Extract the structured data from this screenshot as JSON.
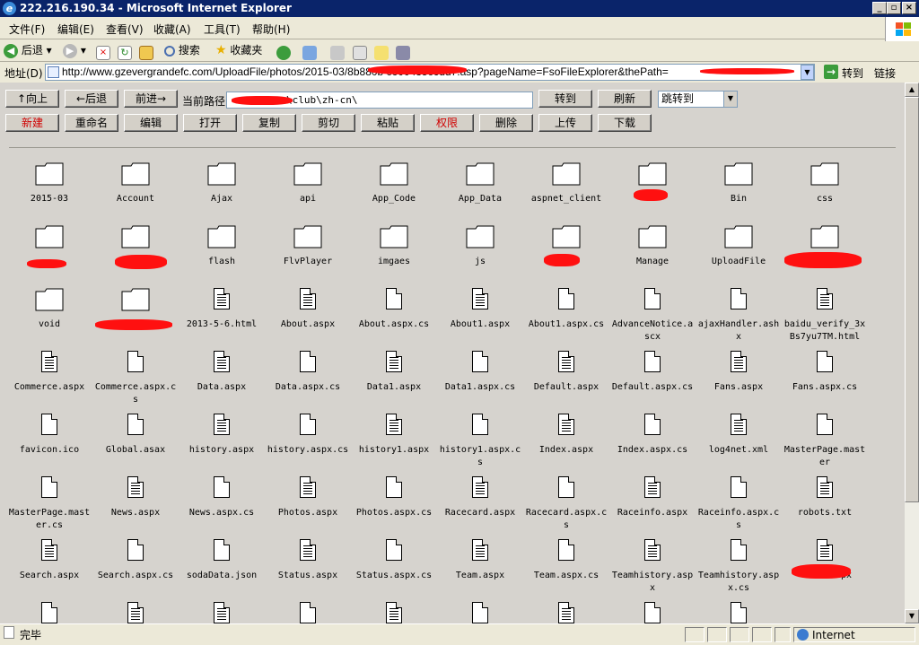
{
  "window": {
    "title": "222.216.190.34 - Microsoft Internet Explorer"
  },
  "menu": [
    "文件(F)",
    "编辑(E)",
    "查看(V)",
    "收藏(A)",
    "工具(T)",
    "帮助(H)"
  ],
  "toolbar": {
    "back": "后退",
    "search": "搜索",
    "favorites": "收藏夹"
  },
  "address": {
    "label": "地址(D)",
    "url": "http://www.gzevergrandefc.com/UploadFile/photos/2015-03/8b880b                       c600435c6dd7.asp?pageName=FsoFileExplorer&thePath=",
    "go": "转到",
    "links": "链接"
  },
  "panel": {
    "up": "↑向上",
    "back": "←后退",
    "forward": "前进→",
    "path_label": "当前路径",
    "path_value": "\\club\\zh-cn\\",
    "go": "转到",
    "refresh": "刷新",
    "jump": "跳转到"
  },
  "actions": [
    "新建",
    "重命名",
    "编辑",
    "打开",
    "复制",
    "剪切",
    "粘贴",
    "权限",
    "删除",
    "上传",
    "下载"
  ],
  "colors": {
    "titlebar": "#0a246a",
    "redact": "#ff1010",
    "red_text": "#d00000"
  },
  "items": [
    {
      "name": "2015-03",
      "type": "folder"
    },
    {
      "name": "Account",
      "type": "folder"
    },
    {
      "name": "Ajax",
      "type": "folder"
    },
    {
      "name": "api",
      "type": "folder"
    },
    {
      "name": "App_Code",
      "type": "folder"
    },
    {
      "name": "App_Data",
      "type": "folder"
    },
    {
      "name": "aspnet_client",
      "type": "folder"
    },
    {
      "name": "",
      "type": "folder",
      "redacted": true
    },
    {
      "name": "Bin",
      "type": "folder"
    },
    {
      "name": "css",
      "type": "folder"
    },
    {
      "name": "",
      "type": "folder",
      "redacted": true
    },
    {
      "name": "",
      "type": "folder",
      "redacted": true
    },
    {
      "name": "flash",
      "type": "folder"
    },
    {
      "name": "FlvPlayer",
      "type": "folder"
    },
    {
      "name": "imgaes",
      "type": "folder"
    },
    {
      "name": "js",
      "type": "folder"
    },
    {
      "name": "",
      "type": "folder",
      "redacted": true
    },
    {
      "name": "Manage",
      "type": "folder"
    },
    {
      "name": "UploadFile",
      "type": "folder"
    },
    {
      "name": "",
      "type": "folder",
      "redacted": true
    },
    {
      "name": "void",
      "type": "folder"
    },
    {
      "name": "",
      "type": "folder",
      "redacted": true
    },
    {
      "name": "2013-5-6.html",
      "type": "text"
    },
    {
      "name": "About.aspx",
      "type": "text"
    },
    {
      "name": "About.aspx.cs",
      "type": "file"
    },
    {
      "name": "About1.aspx",
      "type": "text"
    },
    {
      "name": "About1.aspx.cs",
      "type": "file"
    },
    {
      "name": "AdvanceNotice.ascx",
      "type": "file"
    },
    {
      "name": "ajaxHandler.ashx",
      "type": "file"
    },
    {
      "name": "baidu_verify_3xBs7yu7TM.html",
      "type": "text"
    },
    {
      "name": "Commerce.aspx",
      "type": "text"
    },
    {
      "name": "Commerce.aspx.cs",
      "type": "file"
    },
    {
      "name": "Data.aspx",
      "type": "text"
    },
    {
      "name": "Data.aspx.cs",
      "type": "file"
    },
    {
      "name": "Data1.aspx",
      "type": "text"
    },
    {
      "name": "Data1.aspx.cs",
      "type": "file"
    },
    {
      "name": "Default.aspx",
      "type": "text"
    },
    {
      "name": "Default.aspx.cs",
      "type": "file"
    },
    {
      "name": "Fans.aspx",
      "type": "text"
    },
    {
      "name": "Fans.aspx.cs",
      "type": "file"
    },
    {
      "name": "favicon.ico",
      "type": "file"
    },
    {
      "name": "Global.asax",
      "type": "file"
    },
    {
      "name": "history.aspx",
      "type": "text"
    },
    {
      "name": "history.aspx.cs",
      "type": "file"
    },
    {
      "name": "history1.aspx",
      "type": "text"
    },
    {
      "name": "history1.aspx.cs",
      "type": "file"
    },
    {
      "name": "Index.aspx",
      "type": "text"
    },
    {
      "name": "Index.aspx.cs",
      "type": "file"
    },
    {
      "name": "log4net.xml",
      "type": "text"
    },
    {
      "name": "MasterPage.master",
      "type": "file"
    },
    {
      "name": "MasterPage.master.cs",
      "type": "file"
    },
    {
      "name": "News.aspx",
      "type": "text"
    },
    {
      "name": "News.aspx.cs",
      "type": "file"
    },
    {
      "name": "Photos.aspx",
      "type": "text"
    },
    {
      "name": "Photos.aspx.cs",
      "type": "file"
    },
    {
      "name": "Racecard.aspx",
      "type": "text"
    },
    {
      "name": "Racecard.aspx.cs",
      "type": "file"
    },
    {
      "name": "Raceinfo.aspx",
      "type": "text"
    },
    {
      "name": "Raceinfo.aspx.cs",
      "type": "file"
    },
    {
      "name": "robots.txt",
      "type": "text"
    },
    {
      "name": "Search.aspx",
      "type": "text"
    },
    {
      "name": "Search.aspx.cs",
      "type": "file"
    },
    {
      "name": "sodaData.json",
      "type": "file"
    },
    {
      "name": "Status.aspx",
      "type": "text"
    },
    {
      "name": "Status.aspx.cs",
      "type": "file"
    },
    {
      "name": "Team.aspx",
      "type": "text"
    },
    {
      "name": "Team.aspx.cs",
      "type": "file"
    },
    {
      "name": "Teamhistory.aspx",
      "type": "text"
    },
    {
      "name": "Teamhistory.aspx.cs",
      "type": "file"
    },
    {
      "name": "px",
      "type": "text",
      "redacted": true
    },
    {
      "name": "",
      "type": "file"
    },
    {
      "name": "",
      "type": "text"
    },
    {
      "name": "",
      "type": "text"
    },
    {
      "name": "",
      "type": "file"
    },
    {
      "name": "",
      "type": "text"
    },
    {
      "name": "",
      "type": "file"
    },
    {
      "name": "",
      "type": "text"
    },
    {
      "name": "",
      "type": "file"
    },
    {
      "name": "",
      "type": "file"
    }
  ],
  "status": {
    "left": "完毕",
    "zone": "Internet"
  }
}
